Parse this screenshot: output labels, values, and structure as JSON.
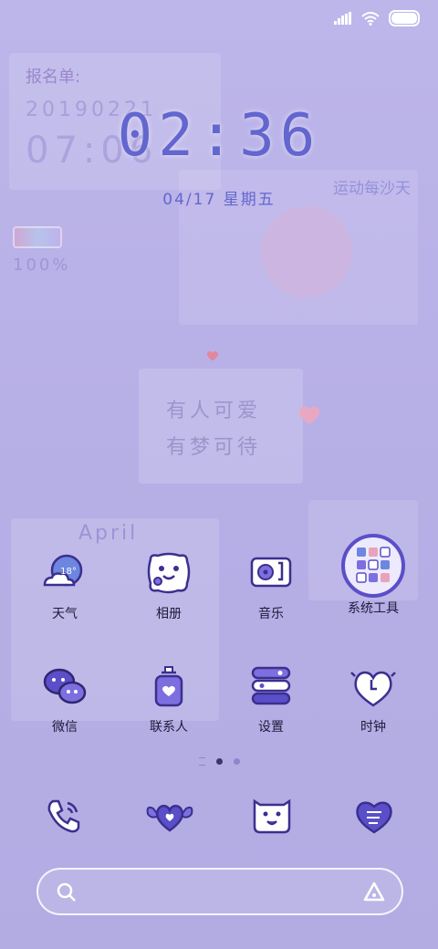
{
  "status_bar": {
    "signal": "signal-icon",
    "wifi": "wifi-icon",
    "battery": "battery-icon"
  },
  "widget": {
    "time": "02:36",
    "date": "04/17 星期五"
  },
  "wallpaper_text": {
    "note_top": "报名单:",
    "note_date": "20190221",
    "note_time": "07:06",
    "battery_pct": "100%",
    "sport_sticker": "运动每沙天",
    "note_center_line1": "有人可爱",
    "note_center_line2": "有梦可待",
    "calendar_month": "April"
  },
  "apps_row1": [
    {
      "label": "天气",
      "icon": "weather-icon",
      "temp": "18°"
    },
    {
      "label": "相册",
      "icon": "gallery-icon"
    },
    {
      "label": "音乐",
      "icon": "music-icon"
    },
    {
      "label": "系统工具",
      "icon": "system-tools-folder-icon"
    }
  ],
  "apps_row2": [
    {
      "label": "微信",
      "icon": "wechat-icon"
    },
    {
      "label": "联系人",
      "icon": "contacts-icon"
    },
    {
      "label": "设置",
      "icon": "settings-icon"
    },
    {
      "label": "时钟",
      "icon": "clock-icon"
    }
  ],
  "page_indicator": {
    "pages": 2,
    "current": 1
  },
  "dock": [
    {
      "icon": "phone-icon"
    },
    {
      "icon": "messages-icon"
    },
    {
      "icon": "camera-icon"
    },
    {
      "icon": "browser-icon"
    }
  ],
  "search_bar": {
    "icon": "search-icon",
    "assistant_icon": "assistant-icon"
  },
  "colors": {
    "accent": "#6366cf",
    "icon_fill": "#5a4fc8",
    "label": "#1e1a3a"
  }
}
